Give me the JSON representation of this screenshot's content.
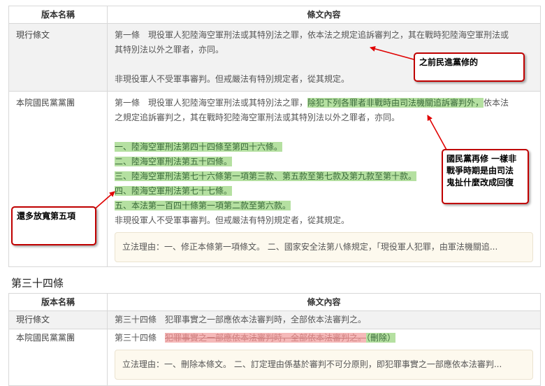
{
  "table1": {
    "headers": [
      "版本名稱",
      "條文內容"
    ],
    "row_current": {
      "version": "現行條文",
      "line1": "第一條　現役軍人犯陸海空軍刑法或其特別法之罪，依本法之規定追訴審判之，其在戰時犯陸海空軍刑法或",
      "line2": "其特別法以外之罪者，亦同。",
      "line3": "非現役軍人不受軍事審判。但戒嚴法有特別規定者，從其規定。"
    },
    "row_kmt": {
      "version": "本院國民黨黨團",
      "line1_pre": "第一條　現役軍人犯陸海空軍刑法或其特別法之罪，",
      "line1_ins": "除犯下列各罪者非戰時由司法機關追訴審判外，",
      "line1_post": "依本法",
      "line2": "之規定追訴審判之，其在戰時犯陸海空軍刑法或其特別法以外之罪者，亦同。",
      "items": [
        "一、陸海空軍刑法第四十四條至第四十六條。",
        "二、陸海空軍刑法第五十四條。",
        "三、陸海空軍刑法第七十六條第一項第三款、第五款至第七款及第九款至第十款。",
        "四、陸海空軍刑法第七十七條。",
        "五、本法第一百四十條第一項第二款至第六款。"
      ],
      "last": "非現役軍人不受軍事審判。但戒嚴法有特別規定者，從其規定。",
      "reason": "立法理由：一、修正本條第一項條文。 二、國家安全法第八條規定，「現役軍人犯罪，由軍法機關追..."
    }
  },
  "section_title": "第三十四條",
  "table2": {
    "headers": [
      "版本名稱",
      "條文內容"
    ],
    "row_current": {
      "version": "現行條文",
      "text": "第三十四條　犯罪事實之一部應依本法審判時，全部依本法審判之。"
    },
    "row_kmt": {
      "version": "本院國民黨黨團",
      "prefix": "第三十四條",
      "deleted": "犯罪事實之一部應依本法審判時，全部依本法審判之。",
      "delete_tag": "（刪除）",
      "reason": "立法理由：一、刪除本條文。 二、訂定理由係基於審判不可分原則，即犯罪事實之一部應依本法審判..."
    }
  },
  "annotations": {
    "note1": "之前民進黨修的",
    "note2": "國民黨再修 一樣非戰爭時期是由司法 鬼扯什麼改成回復",
    "note3": "還多放寬第五項"
  },
  "colors": {
    "insert_bg": "#b5e0a1",
    "delete_bg": "#f5b9b9",
    "note_border": "#c00000",
    "arrow": "#e00000"
  }
}
